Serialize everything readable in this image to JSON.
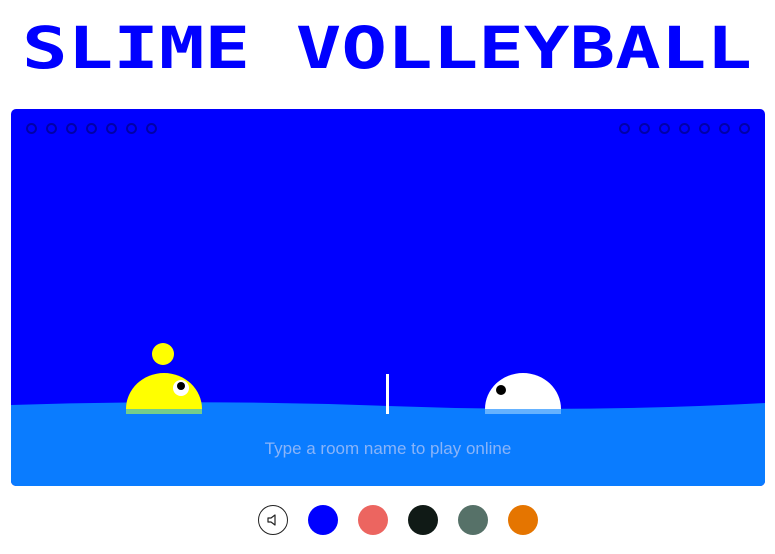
{
  "title": "SLIME VOLLEYBALL",
  "colors": {
    "title": "#0000ff",
    "court": "#0000ff",
    "water": "#0a7cff",
    "left_slime": "#ffff00",
    "right_slime": "#ffffff",
    "ball": "#ffff00",
    "net": "#ffffff"
  },
  "score": {
    "left_points": 0,
    "right_points": 0,
    "max_points": 7
  },
  "room_input": {
    "placeholder": "Type a room name to play online",
    "value": ""
  },
  "controls": {
    "sound_icon": "speaker-icon",
    "theme_colors": [
      "#0000ff",
      "#ec6560",
      "#101a16",
      "#567168",
      "#e57500"
    ]
  }
}
